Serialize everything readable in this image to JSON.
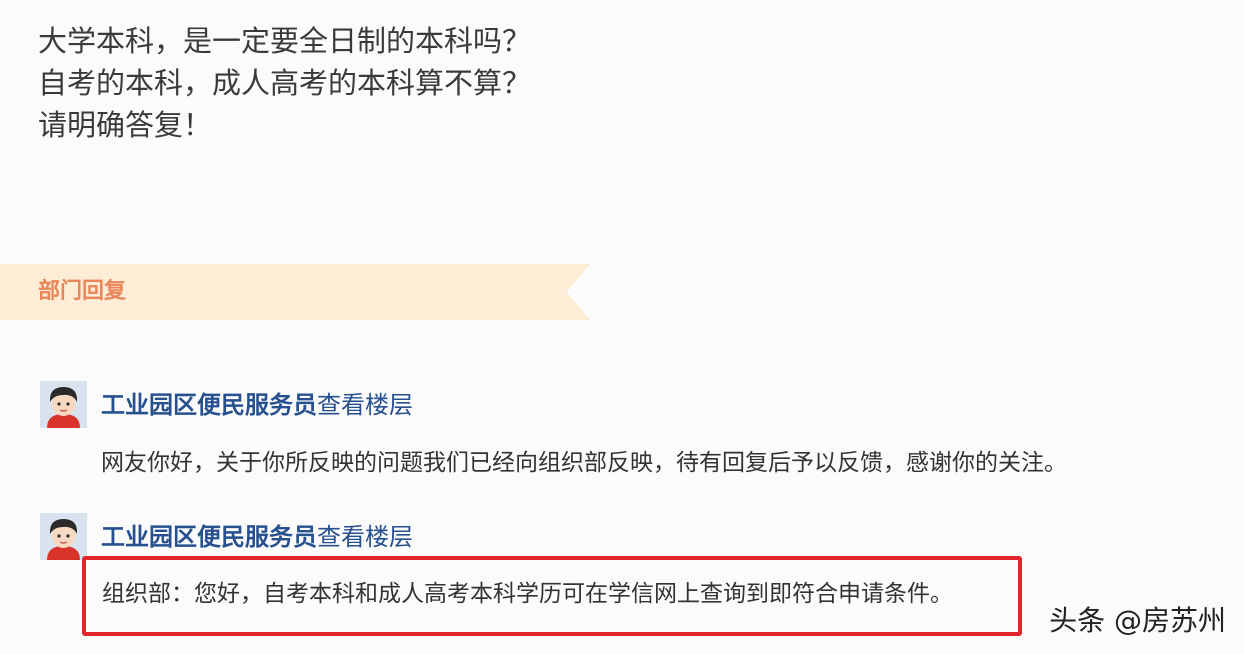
{
  "question": {
    "lines": [
      "大学本科，是一定要全日制的本科吗？",
      "自考的本科，成人高考的本科算不算？",
      "请明确答复！"
    ]
  },
  "section": {
    "title": "部门回复"
  },
  "replies": [
    {
      "author": "工业园区便民服务员",
      "view_floor": "查看楼层",
      "text": "网友你好，关于你所反映的问题我们已经向组织部反映，待有回复后予以反馈，感谢你的关注。"
    },
    {
      "author": "工业园区便民服务员",
      "view_floor": "查看楼层",
      "text": "组织部：您好，自考本科和成人高考本科学历可在学信网上查询到即符合申请条件。"
    }
  ],
  "highlight": {
    "border_color": "#e0252c"
  },
  "watermark": {
    "text": "头条 @房苏州"
  },
  "colors": {
    "link": "#27508f",
    "banner_bg": "#fdecd6",
    "banner_text": "#e8865a"
  }
}
